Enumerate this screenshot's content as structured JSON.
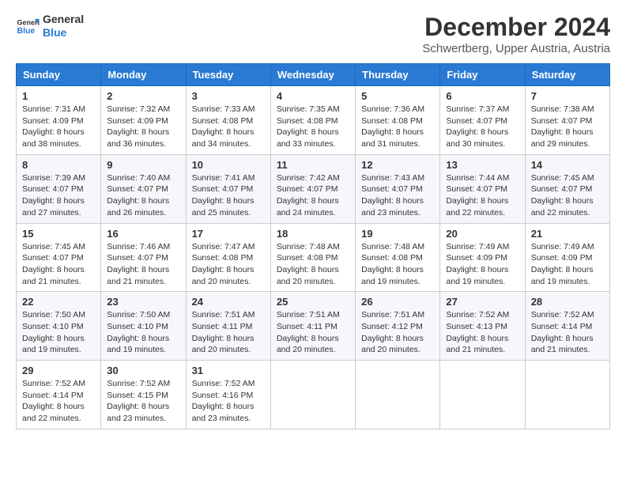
{
  "logo": {
    "general": "General",
    "blue": "Blue"
  },
  "title": "December 2024",
  "location": "Schwertberg, Upper Austria, Austria",
  "days_of_week": [
    "Sunday",
    "Monday",
    "Tuesday",
    "Wednesday",
    "Thursday",
    "Friday",
    "Saturday"
  ],
  "weeks": [
    [
      {
        "day": 1,
        "sunrise": "7:31 AM",
        "sunset": "4:09 PM",
        "daylight": "8 hours and 38 minutes."
      },
      {
        "day": 2,
        "sunrise": "7:32 AM",
        "sunset": "4:09 PM",
        "daylight": "8 hours and 36 minutes."
      },
      {
        "day": 3,
        "sunrise": "7:33 AM",
        "sunset": "4:08 PM",
        "daylight": "8 hours and 34 minutes."
      },
      {
        "day": 4,
        "sunrise": "7:35 AM",
        "sunset": "4:08 PM",
        "daylight": "8 hours and 33 minutes."
      },
      {
        "day": 5,
        "sunrise": "7:36 AM",
        "sunset": "4:08 PM",
        "daylight": "8 hours and 31 minutes."
      },
      {
        "day": 6,
        "sunrise": "7:37 AM",
        "sunset": "4:07 PM",
        "daylight": "8 hours and 30 minutes."
      },
      {
        "day": 7,
        "sunrise": "7:38 AM",
        "sunset": "4:07 PM",
        "daylight": "8 hours and 29 minutes."
      }
    ],
    [
      {
        "day": 8,
        "sunrise": "7:39 AM",
        "sunset": "4:07 PM",
        "daylight": "8 hours and 27 minutes."
      },
      {
        "day": 9,
        "sunrise": "7:40 AM",
        "sunset": "4:07 PM",
        "daylight": "8 hours and 26 minutes."
      },
      {
        "day": 10,
        "sunrise": "7:41 AM",
        "sunset": "4:07 PM",
        "daylight": "8 hours and 25 minutes."
      },
      {
        "day": 11,
        "sunrise": "7:42 AM",
        "sunset": "4:07 PM",
        "daylight": "8 hours and 24 minutes."
      },
      {
        "day": 12,
        "sunrise": "7:43 AM",
        "sunset": "4:07 PM",
        "daylight": "8 hours and 23 minutes."
      },
      {
        "day": 13,
        "sunrise": "7:44 AM",
        "sunset": "4:07 PM",
        "daylight": "8 hours and 22 minutes."
      },
      {
        "day": 14,
        "sunrise": "7:45 AM",
        "sunset": "4:07 PM",
        "daylight": "8 hours and 22 minutes."
      }
    ],
    [
      {
        "day": 15,
        "sunrise": "7:45 AM",
        "sunset": "4:07 PM",
        "daylight": "8 hours and 21 minutes."
      },
      {
        "day": 16,
        "sunrise": "7:46 AM",
        "sunset": "4:07 PM",
        "daylight": "8 hours and 21 minutes."
      },
      {
        "day": 17,
        "sunrise": "7:47 AM",
        "sunset": "4:08 PM",
        "daylight": "8 hours and 20 minutes."
      },
      {
        "day": 18,
        "sunrise": "7:48 AM",
        "sunset": "4:08 PM",
        "daylight": "8 hours and 20 minutes."
      },
      {
        "day": 19,
        "sunrise": "7:48 AM",
        "sunset": "4:08 PM",
        "daylight": "8 hours and 19 minutes."
      },
      {
        "day": 20,
        "sunrise": "7:49 AM",
        "sunset": "4:09 PM",
        "daylight": "8 hours and 19 minutes."
      },
      {
        "day": 21,
        "sunrise": "7:49 AM",
        "sunset": "4:09 PM",
        "daylight": "8 hours and 19 minutes."
      }
    ],
    [
      {
        "day": 22,
        "sunrise": "7:50 AM",
        "sunset": "4:10 PM",
        "daylight": "8 hours and 19 minutes."
      },
      {
        "day": 23,
        "sunrise": "7:50 AM",
        "sunset": "4:10 PM",
        "daylight": "8 hours and 19 minutes."
      },
      {
        "day": 24,
        "sunrise": "7:51 AM",
        "sunset": "4:11 PM",
        "daylight": "8 hours and 20 minutes."
      },
      {
        "day": 25,
        "sunrise": "7:51 AM",
        "sunset": "4:11 PM",
        "daylight": "8 hours and 20 minutes."
      },
      {
        "day": 26,
        "sunrise": "7:51 AM",
        "sunset": "4:12 PM",
        "daylight": "8 hours and 20 minutes."
      },
      {
        "day": 27,
        "sunrise": "7:52 AM",
        "sunset": "4:13 PM",
        "daylight": "8 hours and 21 minutes."
      },
      {
        "day": 28,
        "sunrise": "7:52 AM",
        "sunset": "4:14 PM",
        "daylight": "8 hours and 21 minutes."
      }
    ],
    [
      {
        "day": 29,
        "sunrise": "7:52 AM",
        "sunset": "4:14 PM",
        "daylight": "8 hours and 22 minutes."
      },
      {
        "day": 30,
        "sunrise": "7:52 AM",
        "sunset": "4:15 PM",
        "daylight": "8 hours and 23 minutes."
      },
      {
        "day": 31,
        "sunrise": "7:52 AM",
        "sunset": "4:16 PM",
        "daylight": "8 hours and 23 minutes."
      },
      null,
      null,
      null,
      null
    ]
  ]
}
